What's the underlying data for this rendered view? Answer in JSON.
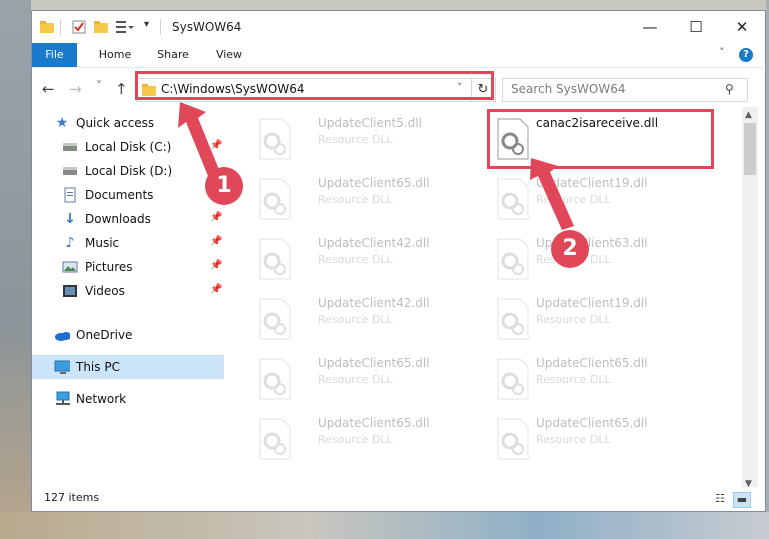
{
  "window": {
    "title": "SysWOW64",
    "controls": {
      "minimize": "—",
      "maximize": "☐",
      "close": "✕"
    }
  },
  "ribbon": {
    "tabs": [
      "File",
      "Home",
      "Share",
      "View"
    ],
    "help": "?"
  },
  "nav": {
    "back": "←",
    "forward": "→",
    "recent": "˅",
    "up": "↑",
    "address": "C:\\Windows\\SysWOW64",
    "search_placeholder": "Search SysWOW64"
  },
  "sidebar": {
    "items": [
      {
        "label": "Quick access",
        "icon": "star-icon",
        "pinned": false
      },
      {
        "label": "Local Disk (C:)",
        "icon": "drive-icon",
        "pinned": true
      },
      {
        "label": "Local Disk (D:)",
        "icon": "drive-icon",
        "pinned": false
      },
      {
        "label": "Documents",
        "icon": "documents-icon",
        "pinned": true
      },
      {
        "label": "Downloads",
        "icon": "downloads-icon",
        "pinned": true
      },
      {
        "label": "Music",
        "icon": "music-icon",
        "pinned": true
      },
      {
        "label": "Pictures",
        "icon": "pictures-icon",
        "pinned": true
      },
      {
        "label": "Videos",
        "icon": "videos-icon",
        "pinned": true
      },
      {
        "label": "OneDrive",
        "icon": "onedrive-icon",
        "pinned": false
      },
      {
        "label": "This PC",
        "icon": "pc-icon",
        "pinned": false,
        "selected": true
      },
      {
        "label": "Network",
        "icon": "network-icon",
        "pinned": false
      }
    ]
  },
  "files": {
    "left_column": [
      {
        "name": "UpdateClient5.dll",
        "type": "Resource DLL"
      },
      {
        "name": "UpdateClient65.dll",
        "type": "Resource DLL"
      },
      {
        "name": "UpdateClient42.dll",
        "type": "Resource DLL"
      },
      {
        "name": "UpdateClient42.dll",
        "type": "Resource DLL"
      },
      {
        "name": "UpdateClient65.dll",
        "type": "Resource DLL"
      },
      {
        "name": "UpdateClient65.dll",
        "type": "Resource DLL"
      }
    ],
    "right_column": [
      {
        "name": "canac2isareceive.dll",
        "type": "",
        "highlighted": true
      },
      {
        "name": "UpdateClient19.dll",
        "type": "Resource DLL"
      },
      {
        "name": "UpdateClient63.dll",
        "type": "Resource DLL"
      },
      {
        "name": "UpdateClient19.dll",
        "type": "Resource DLL"
      },
      {
        "name": "UpdateClient65.dll",
        "type": "Resource DLL"
      },
      {
        "name": "UpdateClient65.dll",
        "type": "Resource DLL"
      }
    ]
  },
  "status": {
    "item_count": "127 items"
  },
  "annotations": {
    "step1": "1",
    "step2": "2",
    "color": "#e0485a"
  }
}
